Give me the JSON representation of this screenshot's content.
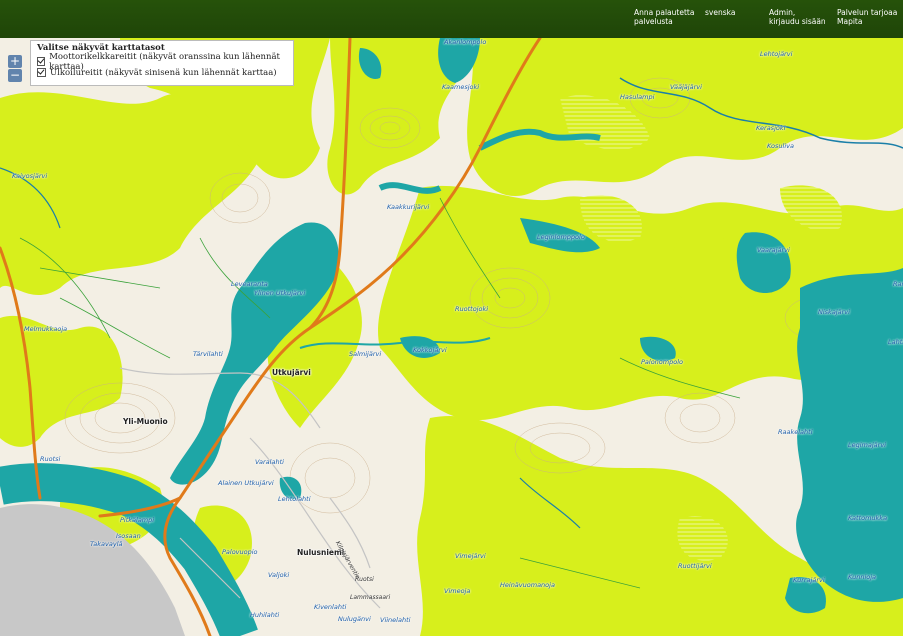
{
  "header": {
    "links": [
      {
        "label": "Anna palautetta\npalvelusta"
      },
      {
        "label": "svenska"
      },
      {
        "label": "Admin,\nkirjaudu sisään"
      },
      {
        "label": "Palvelun tarjoaa\nMapita"
      }
    ]
  },
  "zoom": {
    "in": "+",
    "out": "−"
  },
  "layers": {
    "title": "Valitse näkyvät karttatasot",
    "items": [
      {
        "label": "Moottorikelkkareitit (näkyvät oranssina kun lähennät karttaa)",
        "checked": true
      },
      {
        "label": "Ulkoilureitit (näkyvät sinisenä kun lähennät karttaa)",
        "checked": true
      }
    ]
  },
  "colors": {
    "water": "#1ea6a6",
    "forest": "#d7ef1c",
    "open_land": "#f3efe4",
    "snowmobile_route": "#e07a1a",
    "road": "#c8c8c8",
    "header": "#26520a"
  },
  "places": {
    "towns": [
      "Utkujärvi",
      "Yli-Muonio",
      "Nulusniemi"
    ],
    "water_labels": [
      "Akanlompolo",
      "Kaamesjoki",
      "Lehtojärvi",
      "Hasulampi",
      "Vääjäjärvi",
      "Kerasjoki",
      "Kosuliva",
      "Kaivosjärvi",
      "Kaakkurijärvi",
      "Leginlomppolo",
      "Vaarajärvi",
      "Levearanta",
      "Ylinen Utkujärvi",
      "Ruottojoki",
      "Niskajärvi",
      "Melmukkaoja",
      "Tärvilahti",
      "Salmijärvi",
      "Kokkojärvi",
      "Palonompolo",
      "Ranta",
      "Lahti",
      "Raakelahti",
      "Legimajärvi",
      "Varalahti",
      "Alainen Utkujärvi",
      "Lehtolahti",
      "Pitkälampi",
      "Isosaan",
      "Takavaylä",
      "Palovuopio",
      "Valjoki",
      "Vimejärvi",
      "Vimeoja",
      "Heinävuomanoja",
      "Ruottijärvi",
      "Kurrajärvi",
      "Kunnioja",
      "Kattomukka",
      "Kivenlahti",
      "Nulugänvi",
      "Viinelahti",
      "Huhilahti",
      "Ruotsi"
    ],
    "road_labels": [
      "Kilpisjärventie",
      "Lammassaari",
      "Ruotsi"
    ]
  }
}
